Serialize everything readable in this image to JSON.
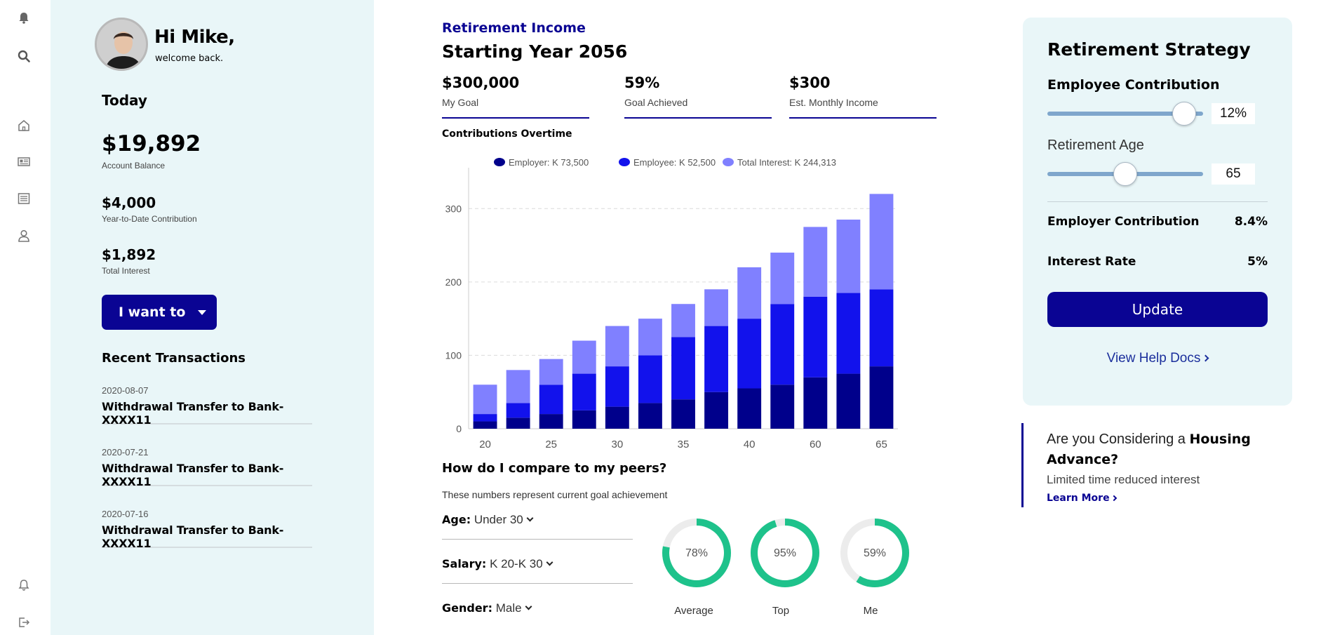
{
  "rail": {
    "icons": [
      "bell-icon",
      "search-icon",
      "home-icon",
      "news-icon",
      "list-icon",
      "user-icon",
      "notification-icon",
      "logout-icon"
    ]
  },
  "profile": {
    "greeting": "Hi Mike,",
    "subtitle": "welcome back."
  },
  "today": {
    "heading": "Today",
    "balance": "$19,892",
    "balance_label": "Account Balance",
    "ytd": "$4,000",
    "ytd_label": "Year-to-Date Contribution",
    "interest": "$1,892",
    "interest_label": "Total Interest"
  },
  "actions": {
    "i_want_to": "I want to"
  },
  "transactions": {
    "heading": "Recent Transactions",
    "items": [
      {
        "date": "2020-08-07",
        "desc": "Withdrawal Transfer to Bank-XXXX11"
      },
      {
        "date": "2020-07-21",
        "desc": "Withdrawal Transfer to Bank-XXXX11"
      },
      {
        "date": "2020-07-16",
        "desc": "Withdrawal Transfer to Bank-XXXX11"
      }
    ]
  },
  "income": {
    "title": "Retirement Income",
    "subtitle": "Starting Year 2056",
    "stats": [
      {
        "value": "$300,000",
        "label": "My Goal"
      },
      {
        "value": "59%",
        "label": "Goal Achieved"
      },
      {
        "value": "$300",
        "label": "Est. Monthly Income"
      }
    ],
    "contrib_heading": "Contributions Overtime"
  },
  "chart_data": {
    "type": "bar",
    "stacked": true,
    "categories": [
      "20",
      "",
      "25",
      "",
      "30",
      "",
      "35",
      "",
      "40",
      "",
      "60",
      "",
      "65"
    ],
    "series": [
      {
        "name": "Employer: K 73,500",
        "color": "#00008b",
        "values": [
          10,
          15,
          20,
          25,
          30,
          35,
          40,
          50,
          55,
          60,
          70,
          75,
          85
        ]
      },
      {
        "name": "Employee: K 52,500",
        "color": "#1212ec",
        "values": [
          10,
          20,
          40,
          50,
          55,
          65,
          85,
          90,
          95,
          110,
          110,
          110,
          105
        ]
      },
      {
        "name": "Total Interest: K 244,313",
        "color": "#8080ff",
        "values": [
          40,
          45,
          35,
          45,
          55,
          50,
          45,
          50,
          70,
          70,
          95,
          100,
          130
        ]
      }
    ],
    "yticks": [
      0,
      100,
      200,
      300
    ],
    "ylim": [
      0,
      350
    ],
    "grid": true,
    "legend": "top"
  },
  "peers": {
    "title": "How do I compare to my peers?",
    "subtitle": "These numbers represent current goal achievement",
    "filters": [
      {
        "label": "Age:",
        "value": "Under 30"
      },
      {
        "label": "Salary:",
        "value": "K 20-K 30"
      },
      {
        "label": "Gender:",
        "value": "Male"
      }
    ],
    "donuts": [
      {
        "name": "Average",
        "percent": 78,
        "text": "78%"
      },
      {
        "name": "Top",
        "percent": 95,
        "text": "95%"
      },
      {
        "name": "Me",
        "percent": 59,
        "text": "59%"
      }
    ],
    "donut_color": "#1ec28b",
    "donut_track": "#ececec"
  },
  "strategy": {
    "title": "Retirement Strategy",
    "employee_contribution_label": "Employee Contribution",
    "employee_contribution_value": "12%",
    "employee_contribution_level": 0.88,
    "retirement_age_label": "Retirement Age",
    "retirement_age_value": "65",
    "retirement_age_level": 0.5,
    "employer_contribution_label": "Employer Contribution",
    "employer_contribution_value": "8.4%",
    "interest_rate_label": "Interest Rate",
    "interest_rate_value": "5%",
    "update_label": "Update",
    "help_label": "View Help Docs"
  },
  "promo": {
    "question_pre": "Are you Considering a ",
    "question_bold": "Housing Advance?",
    "subtitle": "Limited time reduced interest",
    "link": "Learn More"
  },
  "colors": {
    "accent": "#0a0493",
    "panel": "#e9f6f8"
  }
}
